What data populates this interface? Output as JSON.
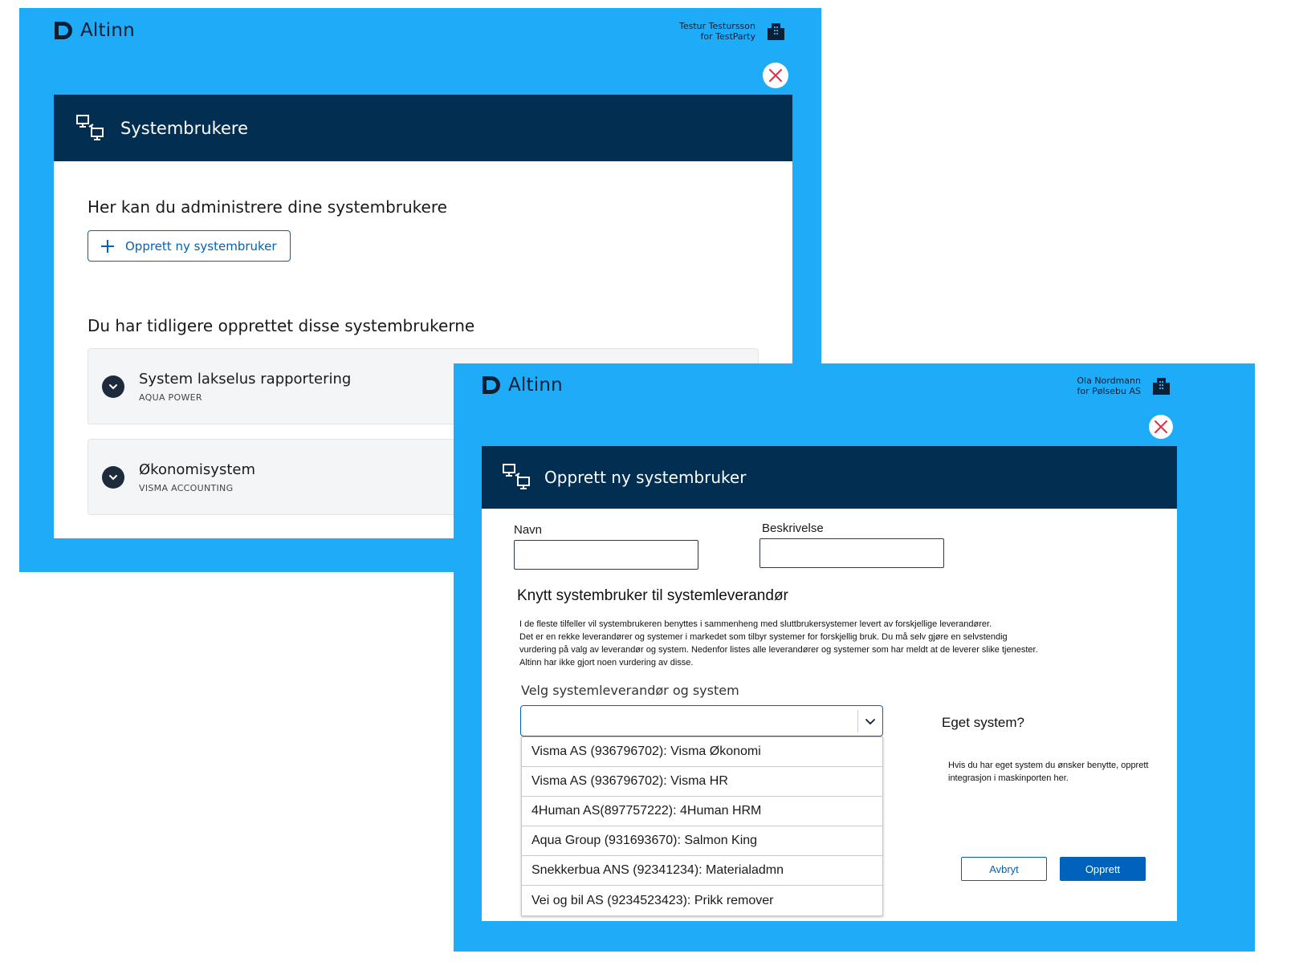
{
  "colors": {
    "brand_blue": "#1eabf7",
    "header_navy": "#022f51",
    "primary": "#0062ba",
    "close_red": "#e02e49"
  },
  "screen1": {
    "logo": "Altinn",
    "user": {
      "name": "Testur Testursson",
      "org": "for TestParty"
    },
    "title": "Systembrukere",
    "heading": "Her kan du administrere dine systembrukere",
    "new_button": "Opprett ny systembruker",
    "list_heading": "Du har tidligere opprettet disse systembrukerne",
    "items": [
      {
        "title": "System lakselus rapportering",
        "subtitle": "AQUA POWER"
      },
      {
        "title": "Økonomisystem",
        "subtitle": "VISMA ACCOUNTING"
      }
    ]
  },
  "screen2": {
    "logo": "Altinn",
    "user": {
      "name": "Ola Nordmann",
      "org": "for Pølsebu AS"
    },
    "title": "Opprett ny systembruker",
    "name_label": "Navn",
    "name_value": "",
    "description_label": "Beskrivelse",
    "description_value": "",
    "connect_heading": "Knytt systembruker til systemleverandør",
    "paragraph": [
      "I de fleste tilfeller vil systembrukeren benyttes i sammenheng med sluttbrukersystemer levert av forskjellige leverandører.",
      "Det er en rekke leverandører og systemer i markedet som tilbyr systemer for forskjellig bruk. Du må selv gjøre en selvstendig",
      "vurdering på valg av leverandør og system.  Nedenfor listes alle leverandører og systemer som har meldt at de leverer slike tjenester.",
      "Altinn har ikke gjort noen vurdering av disse."
    ],
    "select_label": "Velg systemleverandør og system",
    "select_value": "",
    "options": [
      "Visma AS (936796702): Visma Økonomi",
      "Visma AS (936796702): Visma HR",
      "4Human AS(897757222): 4Human HRM",
      "Aqua Group (931693670): Salmon King",
      "Snekkerbua ANS (92341234): Materialadmn",
      "Vei og bil AS (9234523423): Prikk remover"
    ],
    "own_system_title": "Eget system?",
    "own_system_text": "Hvis du har eget system du ønsker benytte, opprett integrasjon i maskinporten her.",
    "cancel_label": "Avbryt",
    "create_label": "Opprett"
  }
}
